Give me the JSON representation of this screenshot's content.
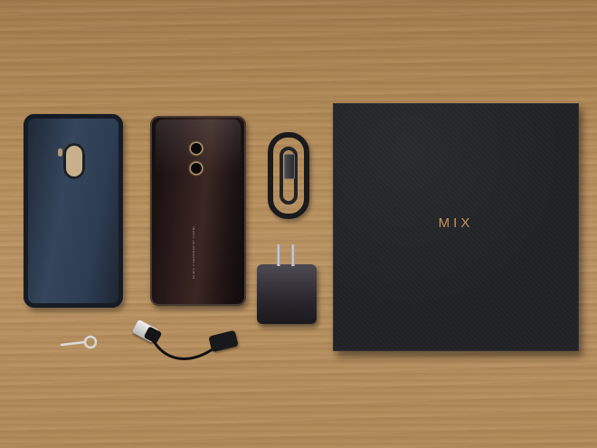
{
  "scene": {
    "description_label": "",
    "box_logo_text": "MIX",
    "phone_print_text": "MI MIX 2 DESIGNED BY XIAOMI",
    "colors": {
      "wood": "#b58d5b",
      "box": "#202226",
      "logo": "#c9915a",
      "case": "#2d3d52",
      "phone": "#2a1a1a"
    }
  }
}
